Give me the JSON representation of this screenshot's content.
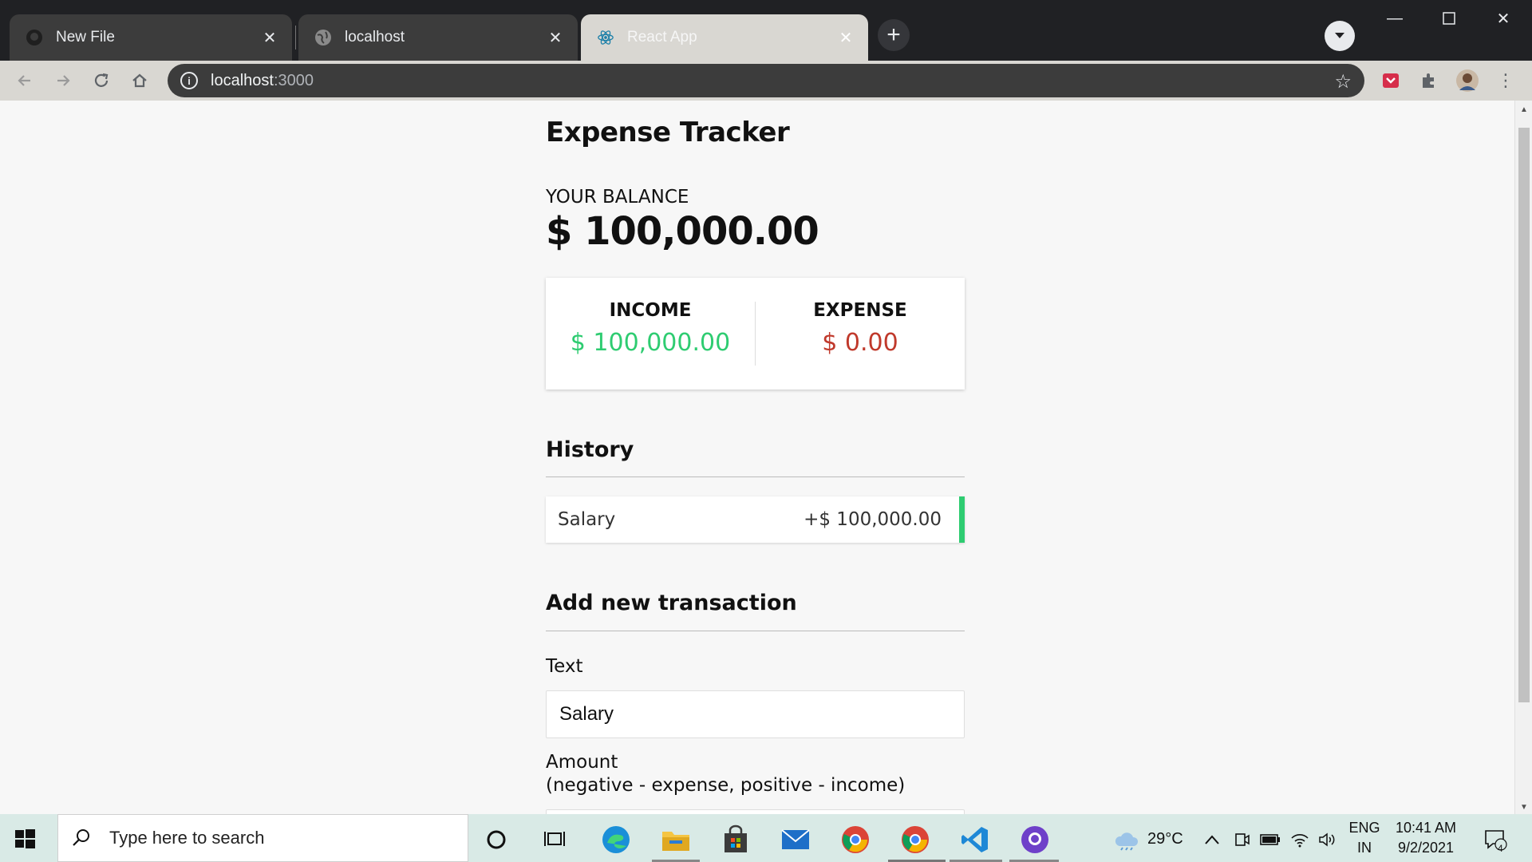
{
  "browser": {
    "tabs": [
      {
        "label": "New File",
        "favicon": "github-icon",
        "active": false
      },
      {
        "label": "localhost",
        "favicon": "globe-icon",
        "active": false
      },
      {
        "label": "React App",
        "favicon": "react-icon",
        "active": true
      }
    ],
    "url_host": "localhost",
    "url_port": ":3000"
  },
  "app": {
    "title": "Expense Tracker",
    "balance_label": "YOUR BALANCE",
    "balance_value": "$ 100,000.00",
    "income_label": "INCOME",
    "income_value": "$ 100,000.00",
    "expense_label": "EXPENSE",
    "expense_value": "$ 0.00",
    "history_title": "History",
    "history": [
      {
        "text": "Salary",
        "amount": "+$ 100,000.00"
      }
    ],
    "add_title": "Add new transaction",
    "text_label": "Text",
    "text_value": "Salary",
    "amount_label": "Amount",
    "amount_hint": "(negative - expense, positive - income)"
  },
  "taskbar": {
    "search_placeholder": "Type here to search",
    "weather": "29°C",
    "lang_top": "ENG",
    "lang_bottom": "IN",
    "time": "10:41 AM",
    "date": "9/2/2021",
    "notification_count": "4"
  },
  "colors": {
    "income": "#2ecc71",
    "expense": "#c0392b",
    "chrome_dark": "#202124",
    "taskbar": "#d9eae6"
  }
}
